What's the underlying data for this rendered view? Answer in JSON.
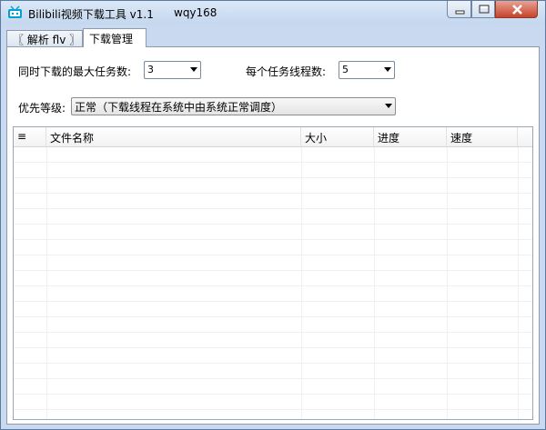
{
  "titlebar": {
    "title": "Bilibili视频下载工具 v1.1",
    "user": "wqy168"
  },
  "tabs": [
    {
      "label": "〖 解析 flv 〗"
    },
    {
      "label": "下载管理"
    }
  ],
  "settings": {
    "max_tasks_label": "同时下载的最大任务数:",
    "max_tasks_value": "3",
    "threads_label": "每个任务线程数:",
    "threads_value": "5",
    "priority_label": "优先等级:",
    "priority_value": "正常（下载线程在系统中由系统正常调度）"
  },
  "table": {
    "columns": [
      "≡",
      "文件名称",
      "大小",
      "进度",
      "速度"
    ]
  },
  "colors": {
    "close": "#c7432a",
    "titlebar": "#c4d7ee"
  }
}
